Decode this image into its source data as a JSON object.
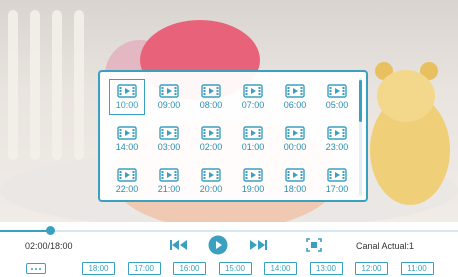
{
  "theme": {
    "accent": "#3aa0bf"
  },
  "popup": {
    "slots": [
      {
        "time": "10:00",
        "selected": true
      },
      {
        "time": "09:00"
      },
      {
        "time": "08:00"
      },
      {
        "time": "07:00"
      },
      {
        "time": "06:00"
      },
      {
        "time": "05:00"
      },
      {
        "time": "14:00"
      },
      {
        "time": "03:00"
      },
      {
        "time": "02:00"
      },
      {
        "time": "01:00"
      },
      {
        "time": "00:00"
      },
      {
        "time": "23:00"
      },
      {
        "time": "22:00"
      },
      {
        "time": "21:00"
      },
      {
        "time": "20:00"
      },
      {
        "time": "19:00"
      },
      {
        "time": "18:00"
      },
      {
        "time": "17:00"
      }
    ],
    "slot_icon": "film-icon"
  },
  "player": {
    "time_label": "02:00/18:00",
    "progress_fraction": 0.11,
    "channel_label": "Canal Actual:1",
    "icons": {
      "prev": "skip-back-icon",
      "play": "play-icon",
      "next": "skip-forward-icon",
      "fullscreen": "fullscreen-icon",
      "more": "more-dots-icon"
    }
  },
  "timeline_tags": [
    "18:00",
    "17:00",
    "16:00",
    "15:00",
    "14:00",
    "13:00",
    "12:00",
    "11:00"
  ]
}
